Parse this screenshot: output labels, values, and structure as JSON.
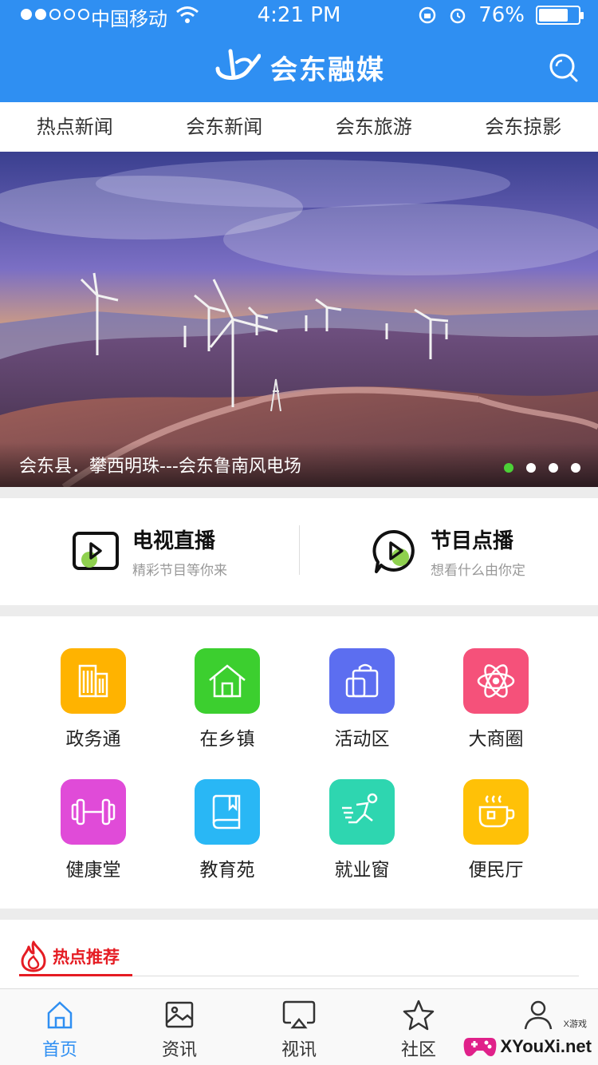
{
  "status_bar": {
    "carrier": "中国移动",
    "time": "4:21 PM",
    "battery": "76%",
    "battery_level": 0.76
  },
  "header": {
    "app_name": "会东融媒",
    "logo_icon": "brand-logo-icon",
    "search_icon": "search-icon"
  },
  "tabs": [
    {
      "label": "热点新闻"
    },
    {
      "label": "会东新闻"
    },
    {
      "label": "会东旅游"
    },
    {
      "label": "会东掠影"
    }
  ],
  "banner": {
    "caption": "会东县．攀西明珠---会东鲁南风电场",
    "slide_count": 4,
    "active_slide": 1
  },
  "media": [
    {
      "title": "电视直播",
      "subtitle": "精彩节目等你来",
      "icon": "tv-live-icon"
    },
    {
      "title": "节目点播",
      "subtitle": "想看什么由你定",
      "icon": "vod-play-icon"
    }
  ],
  "grid": [
    {
      "label": "政务通",
      "icon": "building-icon",
      "color": "#ffb300"
    },
    {
      "label": "在乡镇",
      "icon": "house-icon",
      "color": "#3ccf2f"
    },
    {
      "label": "活动区",
      "icon": "bag-icon",
      "color": "#5c6ef0"
    },
    {
      "label": "大商圈",
      "icon": "atom-icon",
      "color": "#f5517a"
    },
    {
      "label": "健康堂",
      "icon": "dumbbell-icon",
      "color": "#e04bd8"
    },
    {
      "label": "教育苑",
      "icon": "book-icon",
      "color": "#29b7f5"
    },
    {
      "label": "就业窗",
      "icon": "runner-icon",
      "color": "#2ed6b0"
    },
    {
      "label": "便民厅",
      "icon": "coffee-cup-icon",
      "color": "#ffc107"
    }
  ],
  "hot": {
    "title": "热点推荐",
    "icon": "flame-icon"
  },
  "bottom_nav": [
    {
      "label": "首页",
      "icon": "home-icon",
      "active": true
    },
    {
      "label": "资讯",
      "icon": "image-icon",
      "active": false
    },
    {
      "label": "视讯",
      "icon": "airplay-icon",
      "active": false
    },
    {
      "label": "社区",
      "icon": "star-icon",
      "active": false
    },
    {
      "label": "",
      "icon": "user-icon",
      "active": false
    }
  ],
  "watermark": {
    "text": "XYouXi.net",
    "small": "X游戏"
  },
  "colors": {
    "primary": "#2f8ff2",
    "accent_red": "#e51c23",
    "active_dot": "#4cd137"
  }
}
